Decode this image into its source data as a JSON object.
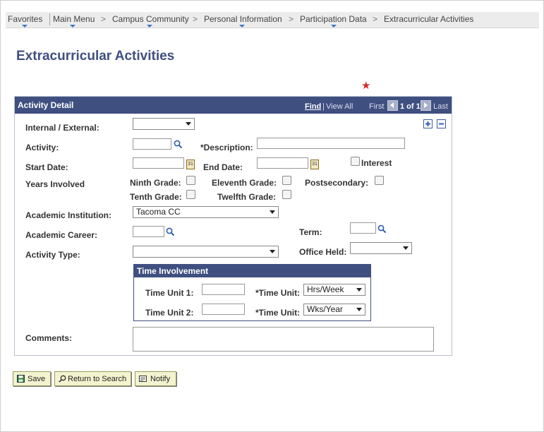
{
  "breadcrumb": {
    "items": [
      "Favorites",
      "Main Menu",
      "Campus Community",
      "Personal Information",
      "Participation Data",
      "Extracurricular Activities"
    ],
    "separator": ">"
  },
  "page": {
    "title": "Extracurricular Activities"
  },
  "activity_detail": {
    "title": "Activity Detail",
    "find_label": "Find",
    "view_all_label": "View All",
    "divider": "|",
    "first_label": "First",
    "page_count": "1 of 1",
    "last_label": "Last",
    "calendar_glyph": "31",
    "fields": {
      "internal_external": {
        "label": "Internal / External:",
        "value": ""
      },
      "activity": {
        "label": "Activity:",
        "value": ""
      },
      "description": {
        "label": "*Description:",
        "value": ""
      },
      "start_date": {
        "label": "Start Date:",
        "value": ""
      },
      "end_date": {
        "label": "End Date:",
        "value": ""
      },
      "interest": {
        "label": "Interest",
        "checked": false
      },
      "years_involved": {
        "label": "Years Involved"
      },
      "ninth_grade": {
        "label": "Ninth Grade:",
        "checked": false
      },
      "eleventh_grade": {
        "label": "Eleventh Grade:",
        "checked": false
      },
      "postsecondary": {
        "label": "Postsecondary:",
        "checked": false
      },
      "tenth_grade": {
        "label": "Tenth Grade:",
        "checked": false
      },
      "twelfth_grade": {
        "label": "Twelfth Grade:",
        "checked": false
      },
      "academic_institution": {
        "label": "Academic Institution:",
        "value": "Tacoma CC"
      },
      "academic_career": {
        "label": "Academic Career:",
        "value": ""
      },
      "term": {
        "label": "Term:",
        "value": ""
      },
      "activity_type": {
        "label": "Activity Type:",
        "value": ""
      },
      "office_held": {
        "label": "Office Held:",
        "value": ""
      },
      "comments": {
        "label": "Comments:",
        "value": ""
      }
    },
    "time_involvement": {
      "title": "Time Involvement",
      "unit1_label": "Time Unit 1:",
      "unit1_value": "",
      "unit1_select_label": "*Time Unit:",
      "unit1_select_value": "Hrs/Week",
      "unit2_label": "Time Unit 2:",
      "unit2_value": "",
      "unit2_select_label": "*Time Unit:",
      "unit2_select_value": "Wks/Year"
    }
  },
  "buttons": {
    "save": "Save",
    "return_to_search": "Return to Search",
    "notify": "Notify"
  },
  "colors": {
    "header": "#3f4f80",
    "title": "#3f4f80",
    "required_star": "#d22a2a",
    "button_bg": "#f3f3d0"
  }
}
